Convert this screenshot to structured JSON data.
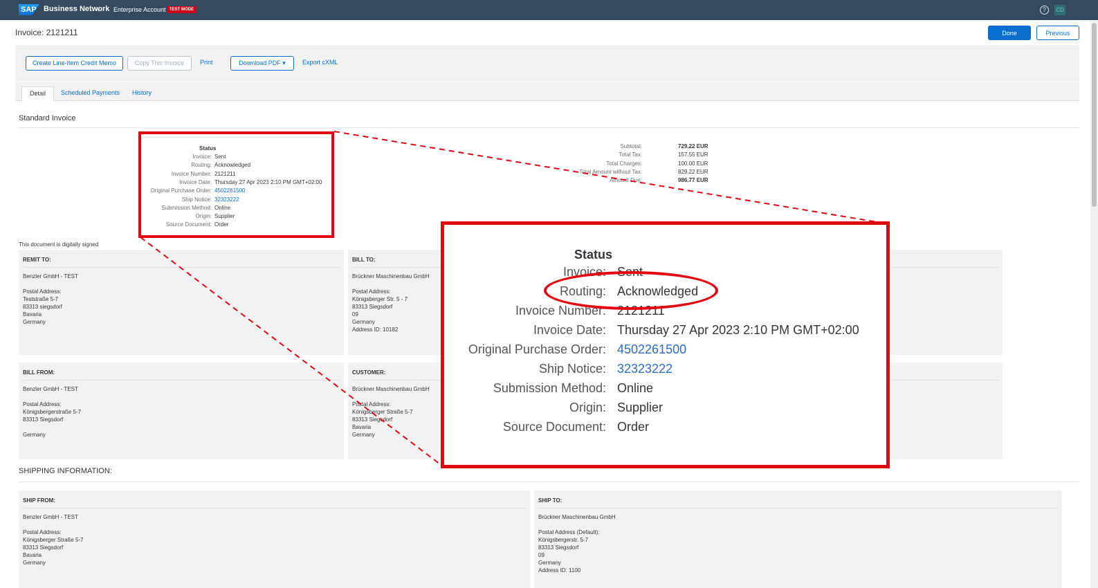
{
  "header": {
    "brand": "Business Network",
    "account": "Enterprise Account",
    "test_mode": "TEST MODE",
    "avatar": "CD"
  },
  "page": {
    "title": "Invoice: 2121211",
    "done": "Done",
    "previous": "Previous"
  },
  "actions": {
    "credit_memo": "Create Line-Item Credit Memo",
    "copy": "Copy This Invoice",
    "print": "Print",
    "download": "Download PDF",
    "export": "Export cXML"
  },
  "tabs": [
    "Detail",
    "Scheduled Payments",
    "History"
  ],
  "section_title": "Standard Invoice",
  "status": {
    "title": "Status",
    "rows": [
      {
        "k": "Invoice:",
        "v": "Sent"
      },
      {
        "k": "Routing:",
        "v": "Acknowledged"
      },
      {
        "k": "Invoice Number:",
        "v": "2121211"
      },
      {
        "k": "Invoice Date:",
        "v": "Thursday 27 Apr 2023 2:10 PM GMT+02:00"
      },
      {
        "k": "Original Purchase Order:",
        "v": "4502261500"
      },
      {
        "k": "Ship Notice:",
        "v": "32323222"
      },
      {
        "k": "Submission Method:",
        "v": "Online"
      },
      {
        "k": "Origin:",
        "v": "Supplier"
      },
      {
        "k": "Source Document:",
        "v": "Order"
      }
    ]
  },
  "totals": [
    {
      "k": "Subtotal:",
      "v": "729.22 EUR"
    },
    {
      "k": "Total Tax:",
      "v": "157.55 EUR"
    },
    {
      "k": "Total Charges:",
      "v": "100.00 EUR"
    },
    {
      "k": "Total Amount without Tax:",
      "v": "829.22 EUR"
    },
    {
      "k": "Amount Due:",
      "v": "986.77 EUR"
    }
  ],
  "signed": "This document is digitally signed",
  "remit_to": {
    "heading": "REMIT TO:",
    "lines": [
      "Benzler GmbH - TEST",
      "",
      "Postal Address:",
      "Teststraße 5-7",
      "83313 siegsdorf",
      "Bavaria",
      "Germany"
    ]
  },
  "bill_to": {
    "heading": "BILL TO:",
    "lines": [
      "Brückner Maschinenbau GmbH",
      "",
      "Postal Address:",
      "Königsberger Str. 5 - 7",
      "83313 Siegsdorf",
      "09",
      "Germany",
      "Address ID: 10182"
    ]
  },
  "bill_from": {
    "heading": "BILL FROM:",
    "lines": [
      "Benzler GmbH - TEST",
      "",
      "Postal Address:",
      "Königsbergerstraße 5-7",
      "83313 Siegsdorf",
      "",
      "Germany"
    ]
  },
  "customer": {
    "heading": "CUSTOMER:",
    "lines": [
      "Brückner Maschinenbau GmbH",
      "",
      "Postal Address:",
      "Königsberger Straße 5-7",
      "83313 Siegsdorf",
      "Bavaria",
      "Germany"
    ]
  },
  "shipping_title": "SHIPPING INFORMATION:",
  "ship_from": {
    "heading": "SHIP FROM:",
    "lines": [
      "Benzler GmbH - TEST",
      "",
      "Postal Address:",
      "Königsberger Straße 5-7",
      "83313 Siegsdorf",
      "Bavaria",
      "Germany"
    ]
  },
  "ship_to": {
    "heading": "SHIP TO:",
    "lines": [
      "Brückner Maschinenbau GmbH",
      "",
      "Postal Address (Default):",
      "Königsbergerstr. 5-7",
      "83313 Siegsdorf",
      "09",
      "Germany",
      "Address ID: 1100"
    ]
  },
  "colors": {
    "accent": "#0a6ed1",
    "shell": "#354a5f",
    "highlight": "#e30613"
  }
}
